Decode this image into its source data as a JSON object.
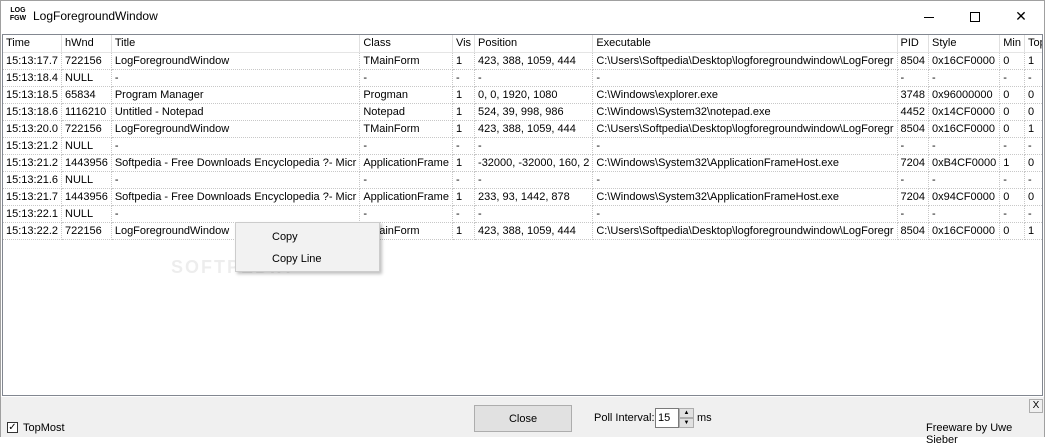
{
  "window": {
    "icon_text_top": "LOG",
    "icon_text_bottom": "FGW",
    "title": "LogForegroundWindow",
    "min_glyph": "",
    "close_glyph": "✕"
  },
  "table": {
    "columns": [
      "Time",
      "hWnd",
      "Title",
      "Class",
      "Vis",
      "Position",
      "Executable",
      "PID",
      "Style",
      "Min",
      "Top"
    ],
    "rows": [
      [
        "15:13:17.7",
        "722156",
        "LogForegroundWindow",
        "TMainForm",
        "1",
        "423, 388, 1059, 444",
        "C:\\Users\\Softpedia\\Desktop\\logforegroundwindow\\LogForegr",
        "8504",
        "0x16CF0000",
        "0",
        "1"
      ],
      [
        "15:13:18.4",
        "NULL",
        "-",
        "-",
        "-",
        "-",
        "-",
        "-",
        "-",
        "-",
        "-"
      ],
      [
        "15:13:18.5",
        "65834",
        "Program Manager",
        "Progman",
        "1",
        "0, 0, 1920, 1080",
        "C:\\Windows\\explorer.exe",
        "3748",
        "0x96000000",
        "0",
        "0"
      ],
      [
        "15:13:18.6",
        "1116210",
        "Untitled - Notepad",
        "Notepad",
        "1",
        "524, 39, 998, 986",
        "C:\\Windows\\System32\\notepad.exe",
        "4452",
        "0x14CF0000",
        "0",
        "0"
      ],
      [
        "15:13:20.0",
        "722156",
        "LogForegroundWindow",
        "TMainForm",
        "1",
        "423, 388, 1059, 444",
        "C:\\Users\\Softpedia\\Desktop\\logforegroundwindow\\LogForegr",
        "8504",
        "0x16CF0000",
        "0",
        "1"
      ],
      [
        "15:13:21.2",
        "NULL",
        "-",
        "-",
        "-",
        "-",
        "-",
        "-",
        "-",
        "-",
        "-"
      ],
      [
        "15:13:21.2",
        "1443956",
        "Softpedia - Free Downloads Encyclopedia ?- Micr",
        "ApplicationFrame",
        "1",
        "-32000, -32000, 160, 2",
        "C:\\Windows\\System32\\ApplicationFrameHost.exe",
        "7204",
        "0xB4CF0000",
        "1",
        "0"
      ],
      [
        "15:13:21.6",
        "NULL",
        "-",
        "-",
        "-",
        "-",
        "-",
        "-",
        "-",
        "-",
        "-"
      ],
      [
        "15:13:21.7",
        "1443956",
        "Softpedia - Free Downloads Encyclopedia ?- Micr",
        "ApplicationFrame",
        "1",
        "233, 93, 1442, 878",
        "C:\\Windows\\System32\\ApplicationFrameHost.exe",
        "7204",
        "0x94CF0000",
        "0",
        "0"
      ],
      [
        "15:13:22.1",
        "NULL",
        "-",
        "-",
        "-",
        "-",
        "-",
        "-",
        "-",
        "-",
        "-"
      ],
      [
        "15:13:22.2",
        "722156",
        "LogForegroundWindow",
        "TMainForm",
        "1",
        "423, 388, 1059, 444",
        "C:\\Users\\Softpedia\\Desktop\\logforegroundwindow\\LogForegr",
        "8504",
        "0x16CF0000",
        "0",
        "1"
      ]
    ]
  },
  "context_menu": {
    "copy": "Copy",
    "copy_line": "Copy Line"
  },
  "watermark": "SOFTPEDIA",
  "footer": {
    "topmost_checked": "✓",
    "topmost_label": "TopMost",
    "close_label": "Close",
    "poll_label": "Poll Interval:",
    "poll_value": "15",
    "poll_unit": "ms",
    "spin_up": "▲",
    "spin_down": "▼",
    "x_label": "X",
    "credit": "Freeware by Uwe Sieber"
  },
  "colors": {
    "window_border": "#a0a0a0",
    "status_bg": "#f0f0f0",
    "menu_bg": "#f2f2f2"
  }
}
